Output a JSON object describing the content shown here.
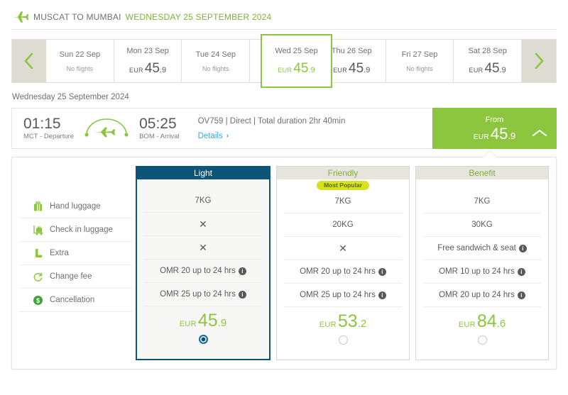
{
  "header": {
    "plane_icon": "airplane-icon",
    "route": "MUSCAT TO MUMBAI",
    "date": "WEDNESDAY 25 SEPTEMBER 2024"
  },
  "date_strip": {
    "prev_label": "‹",
    "next_label": "›",
    "currency": "EUR",
    "cells": [
      {
        "day": "Sun 22 Sep",
        "no_flights": "No flights",
        "major": "",
        "minor": "",
        "selected": false
      },
      {
        "day": "Mon 23 Sep",
        "no_flights": "",
        "major": "45",
        "minor": ".9",
        "selected": false
      },
      {
        "day": "Tue 24 Sep",
        "no_flights": "No flights",
        "major": "",
        "minor": "",
        "selected": false
      },
      {
        "day": "Wed 25 Sep",
        "no_flights": "",
        "major": "45",
        "minor": ".9",
        "selected": true
      },
      {
        "day": "Thu 26 Sep",
        "no_flights": "",
        "major": "45",
        "minor": ".9",
        "selected": false
      },
      {
        "day": "Fri 27 Sep",
        "no_flights": "No flights",
        "major": "",
        "minor": "",
        "selected": false
      },
      {
        "day": "Sat 28 Sep",
        "no_flights": "",
        "major": "45",
        "minor": ".9",
        "selected": false
      }
    ]
  },
  "sub_date": "Wednesday 25 September 2024",
  "flight": {
    "depart_time": "01:15",
    "depart_label": "MCT - Departure",
    "arrive_time": "05:25",
    "arrive_label": "BOM - Arrival",
    "info": "OV759 | Direct | Total duration 2hr 40min",
    "details_label": "Details",
    "details_chevron": "›",
    "from_label": "From",
    "from_currency": "EUR",
    "from_major": "45",
    "from_minor": ".9",
    "collapse_icon": "chevron-up-icon"
  },
  "fare_table": {
    "features": [
      {
        "icon": "suitcase-icon",
        "label": "Hand luggage"
      },
      {
        "icon": "luggage-trolley-icon",
        "label": "Check in luggage"
      },
      {
        "icon": "seat-icon",
        "label": "Extra"
      },
      {
        "icon": "refresh-icon",
        "label": "Change fee"
      },
      {
        "icon": "dollar-circle-icon",
        "label": "Cancellation"
      }
    ],
    "columns": [
      {
        "name": "Light",
        "badge": "",
        "selected": true,
        "cells": [
          {
            "text": "7KG",
            "cross": false,
            "info": false
          },
          {
            "text": "",
            "cross": true,
            "info": false
          },
          {
            "text": "",
            "cross": true,
            "info": false
          },
          {
            "text": "OMR 20 up to 24 hrs",
            "cross": false,
            "info": true
          },
          {
            "text": "OMR 25 up to 24 hrs",
            "cross": false,
            "info": true
          }
        ],
        "currency": "EUR",
        "price_major": "45",
        "price_minor": ".9"
      },
      {
        "name": "Friendly",
        "badge": "Most Popular",
        "selected": false,
        "cells": [
          {
            "text": "7KG",
            "cross": false,
            "info": false
          },
          {
            "text": "20KG",
            "cross": false,
            "info": false
          },
          {
            "text": "",
            "cross": true,
            "info": false
          },
          {
            "text": "OMR 20 up to 24 hrs",
            "cross": false,
            "info": true
          },
          {
            "text": "OMR 25 up to 24 hrs",
            "cross": false,
            "info": true
          }
        ],
        "currency": "EUR",
        "price_major": "53",
        "price_minor": ".2"
      },
      {
        "name": "Benefit",
        "badge": "",
        "selected": false,
        "cells": [
          {
            "text": "7KG",
            "cross": false,
            "info": false
          },
          {
            "text": "30KG",
            "cross": false,
            "info": false
          },
          {
            "text": "Free sandwich & seat",
            "cross": false,
            "info": true
          },
          {
            "text": "OMR 10 up to 24 hrs",
            "cross": false,
            "info": true
          },
          {
            "text": "OMR 20 up to 24 hrs",
            "cross": false,
            "info": true
          }
        ],
        "currency": "EUR",
        "price_major": "84",
        "price_minor": ".6"
      }
    ]
  },
  "colors": {
    "brand_green": "#8cc63f",
    "dark_teal": "#0d5578",
    "badge_yellow": "#d7e021",
    "link_blue": "#36a9e1",
    "strip_grey": "#dedcd2"
  }
}
